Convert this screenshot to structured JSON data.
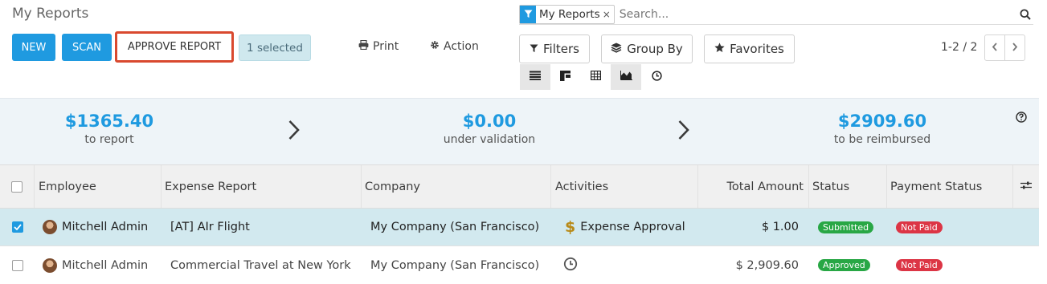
{
  "header": {
    "title": "My Reports"
  },
  "toolbar": {
    "new_label": "NEW",
    "scan_label": "SCAN",
    "approve_label": "APPROVE REPORT",
    "selected_count": "1",
    "selected_label": "selected",
    "print_label": "Print",
    "action_label": "Action"
  },
  "search": {
    "facet_label": "My Reports",
    "facet_remove": "×",
    "placeholder": "Search..."
  },
  "filters": {
    "filters_label": "Filters",
    "groupby_label": "Group By",
    "favorites_label": "Favorites"
  },
  "pager": {
    "text": "1-2 / 2"
  },
  "views": [
    "list-view-icon",
    "kanban-view-icon",
    "pivot-view-icon",
    "graph-view-icon",
    "activity-view-icon"
  ],
  "summary": {
    "to_report_value": "$1365.40",
    "to_report_label": "to report",
    "validation_value": "$0.00",
    "validation_label": "under validation",
    "reimbursed_value": "$2909.60",
    "reimbursed_label": "to be reimbursed"
  },
  "table": {
    "columns": {
      "employee": "Employee",
      "report": "Expense Report",
      "company": "Company",
      "activities": "Activities",
      "total": "Total Amount",
      "status": "Status",
      "payment": "Payment Status"
    },
    "rows": [
      {
        "employee": "Mitchell Admin",
        "report": "[AT] AIr Flight",
        "company": "My Company (San Francisco)",
        "activity": "Expense Approval",
        "activity_symbol": "$",
        "total": "$ 1.00",
        "status": "Submitted",
        "payment": "Not Paid"
      },
      {
        "employee": "Mitchell Admin",
        "report": "Commercial Travel at New York",
        "company": "My Company (San Francisco)",
        "activity": "",
        "total": "$ 2,909.60",
        "status": "Approved",
        "payment": "Not Paid"
      }
    ]
  },
  "colors": {
    "primary": "#1f9ae0",
    "highlight_border": "#d9492f",
    "selected_row": "#d2e9ef",
    "summary_bg": "#eef4f8",
    "badge_green": "#28a745",
    "badge_red": "#dc3545"
  }
}
